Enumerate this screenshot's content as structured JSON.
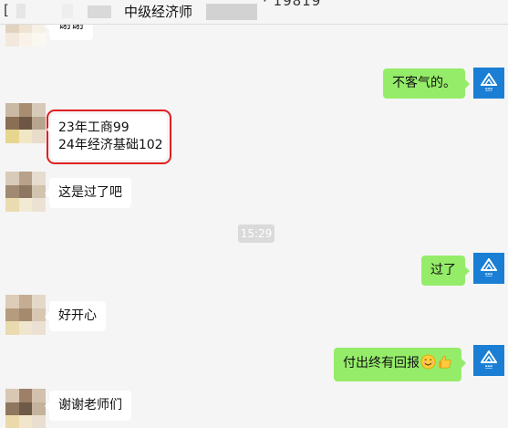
{
  "header": {
    "bracket": "[",
    "title": "中级经济师",
    "suffix": "· 19819"
  },
  "timestamp": "15:29",
  "messages": [
    {
      "side": "in",
      "text": "谢谢"
    },
    {
      "side": "out",
      "text": "不客气的。"
    },
    {
      "side": "in",
      "lines": [
        "23年工商99",
        "24年经济基础102"
      ],
      "highlighted": true
    },
    {
      "side": "in",
      "text": "这是过了吧"
    },
    {
      "side": "out",
      "text": "过了"
    },
    {
      "side": "in",
      "text": "好开心"
    },
    {
      "side": "out",
      "text": "付出终有回报",
      "emojis": [
        "smile-emoji",
        "thumbs-up-emoji"
      ]
    },
    {
      "side": "in",
      "text": "谢谢老师们"
    }
  ],
  "icons": {
    "teacher_avatar": "school-logo-icon",
    "student_avatar": "pixelated-avatar"
  },
  "colors": {
    "background": "#f5f5f5",
    "outgoing_bubble": "#95ec69",
    "incoming_bubble": "#ffffff",
    "highlight_border": "#e02020",
    "logo_blue": "#1a7fd4"
  }
}
